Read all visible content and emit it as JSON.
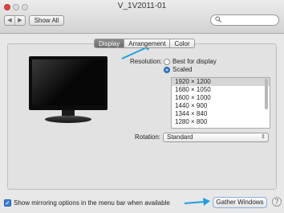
{
  "window": {
    "title": "V_1V2011-01"
  },
  "toolbar": {
    "back_glyph": "◀",
    "forward_glyph": "▶",
    "show_all_label": "Show All",
    "search_value": "",
    "search_glyph": "🔍"
  },
  "tabs": [
    {
      "label": "Display",
      "active": true
    },
    {
      "label": "Arrangement",
      "active": false
    },
    {
      "label": "Color",
      "active": false
    }
  ],
  "resolution": {
    "label": "Resolution:",
    "option_best": "Best for display",
    "option_scaled": "Scaled",
    "selected_option": "Scaled",
    "list": [
      "1920 × 1200",
      "1680 × 1050",
      "1600 × 1000",
      "1440 × 900",
      "1344 × 840",
      "1280 × 800"
    ],
    "selected_index": 0
  },
  "rotation": {
    "label": "Rotation:",
    "value": "Standard",
    "arrows_glyph": "⇕"
  },
  "footer": {
    "mirroring_checked": true,
    "check_glyph": "✓",
    "mirroring_label": "Show mirroring options in the menu bar when available",
    "gather_label": "Gather Windows",
    "help_label": "?"
  },
  "colors": {
    "accent": "#3b7fd8",
    "annotation_arrow": "#1f9ee0"
  }
}
